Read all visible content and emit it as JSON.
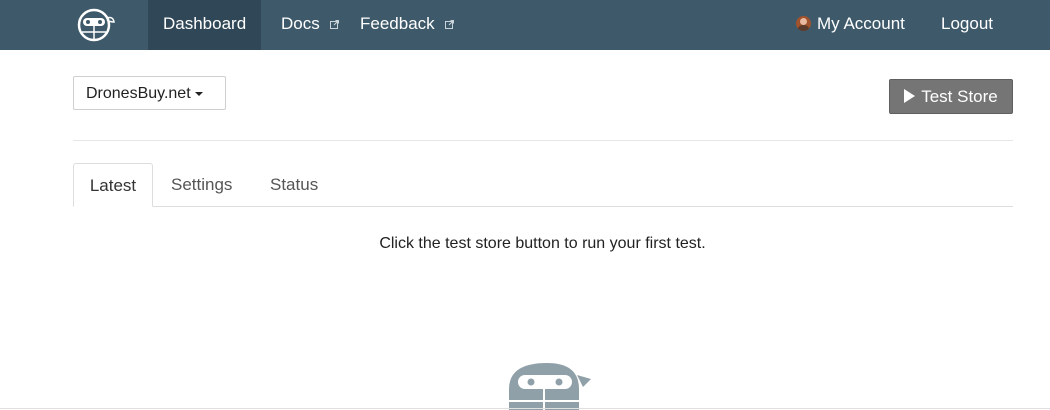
{
  "nav": {
    "items": [
      {
        "label": "Dashboard",
        "active": true
      },
      {
        "label": "Docs",
        "external": true
      },
      {
        "label": "Feedback",
        "external": true
      }
    ],
    "account_label": "My Account",
    "logout_label": "Logout"
  },
  "store": {
    "selected": "DronesBuy.net",
    "test_button_label": "Test Store"
  },
  "tabs": [
    {
      "label": "Latest",
      "active": true
    },
    {
      "label": "Settings"
    },
    {
      "label": "Status"
    }
  ],
  "latest": {
    "message": "Click the test store button to run your first test."
  },
  "colors": {
    "navbar": "#3e5a6a",
    "navbar_active": "#2f4756",
    "test_button": "#757575",
    "mascot": "#90a0a9"
  }
}
